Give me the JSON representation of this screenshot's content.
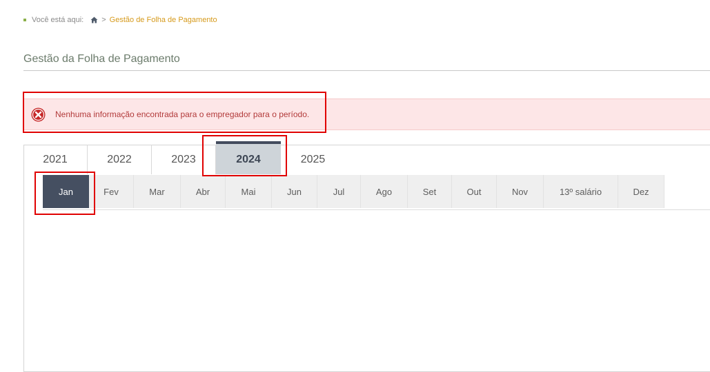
{
  "breadcrumb": {
    "prefix": "Você está aqui:",
    "separator": ">",
    "current": "Gestão de Folha de Pagamento",
    "home_icon": "home-icon"
  },
  "page": {
    "title": "Gestão da Folha de Pagamento"
  },
  "alert": {
    "icon": "error-x-icon",
    "message": "Nenhuma informação encontrada para o empregador para o período."
  },
  "years": {
    "tabs": [
      "2021",
      "2022",
      "2023",
      "2024",
      "2025"
    ],
    "selected": "2024"
  },
  "months": {
    "tabs": [
      "Jan",
      "Fev",
      "Mar",
      "Abr",
      "Mai",
      "Jun",
      "Jul",
      "Ago",
      "Set",
      "Out",
      "Nov",
      "13º salário",
      "Dez"
    ],
    "selected": "Jan"
  },
  "colors": {
    "alert_background": "#fde6e7",
    "alert_text": "#b23a3a",
    "breadcrumb_current": "#d69a1c",
    "active_month": "#454f61",
    "active_year": "#ced4d9",
    "annotation_box": "#e00000"
  }
}
